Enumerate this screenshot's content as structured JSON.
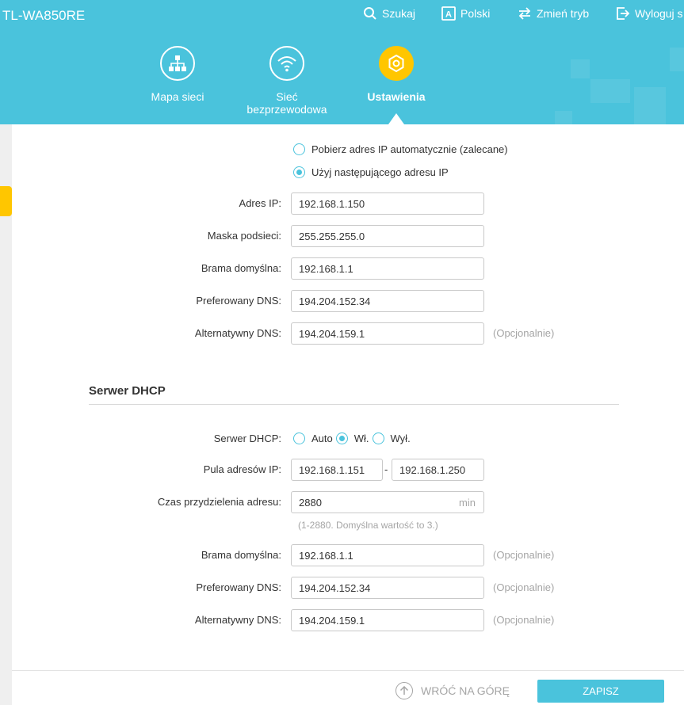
{
  "header": {
    "brand": "TL-WA850RE",
    "topnav": [
      {
        "label": "Szukaj",
        "icon": "search-icon"
      },
      {
        "label": "Polski",
        "icon": "language-icon"
      },
      {
        "label": "Zmień tryb",
        "icon": "switch-mode-icon"
      },
      {
        "label": "Wyloguj s",
        "icon": "logout-icon"
      }
    ],
    "mainnav": [
      {
        "label": "Mapa sieci",
        "icon": "network-map-icon"
      },
      {
        "label": "Sieć bezprzewodowa",
        "icon": "wifi-icon"
      },
      {
        "label": "Ustawienia",
        "icon": "settings-gear-icon",
        "active": true
      }
    ],
    "colors": {
      "header_bg": "#4ac3dc",
      "accent": "#ffc600"
    }
  },
  "ip_settings": {
    "radio_auto": "Pobierz adres IP automatycznie (zalecane)",
    "radio_manual": "Użyj następującego adresu IP",
    "selected": "manual",
    "fields": [
      {
        "label": "Adres IP:",
        "value": "192.168.1.150"
      },
      {
        "label": "Maska podsieci:",
        "value": "255.255.255.0"
      },
      {
        "label": "Brama domyślna:",
        "value": "192.168.1.1"
      },
      {
        "label": "Preferowany DNS:",
        "value": "194.204.152.34"
      },
      {
        "label": "Alternatywny DNS:",
        "value": "194.204.159.1",
        "optional": "(Opcjonalnie)"
      }
    ]
  },
  "dhcp": {
    "section_title": "Serwer DHCP",
    "server_label": "Serwer DHCP:",
    "options": [
      "Auto",
      "Wł.",
      "Wył."
    ],
    "selected": "Wł.",
    "pool_label": "Pula adresów IP:",
    "pool_start": "192.168.1.151",
    "pool_sep": "-",
    "pool_end": "192.168.1.250",
    "lease_label": "Czas przydzielenia adresu:",
    "lease_value": "2880",
    "lease_unit": "min",
    "lease_hint": "(1-2880. Domyślna wartość to 3.)",
    "gateway_label": "Brama domyślna:",
    "gateway_value": "192.168.1.1",
    "pdns_label": "Preferowany DNS:",
    "pdns_value": "194.204.152.34",
    "adns_label": "Alternatywny DNS:",
    "adns_value": "194.204.159.1",
    "optional": "(Opcjonalnie)"
  },
  "footer": {
    "back_to_top": "WRÓĆ NA GÓRĘ",
    "save": "ZAPISZ"
  }
}
